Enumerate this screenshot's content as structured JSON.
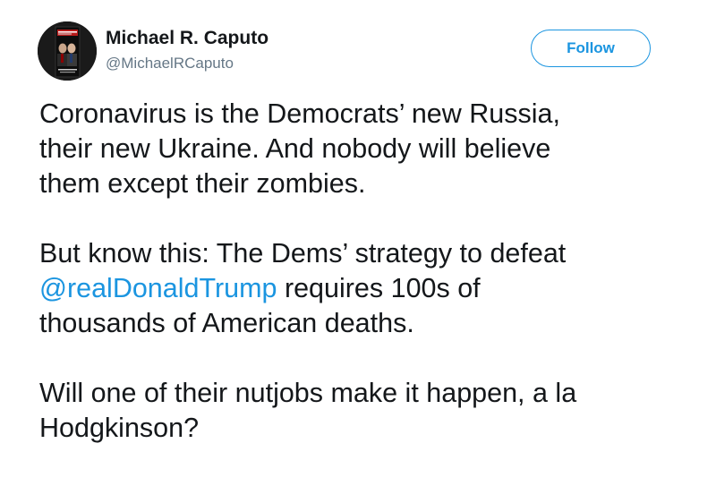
{
  "author": {
    "name": "Michael R. Caputo",
    "handle": "@MichaelRCaputo"
  },
  "follow_button": {
    "label": "Follow"
  },
  "tweet": {
    "p1_l1": "Coronavirus is the Democrats’ new Russia,",
    "p1_l2": "their new Ukraine. And nobody will believe",
    "p1_l3": "them except their zombies.",
    "p2_l1": "But know this: The Dems’ strategy to defeat",
    "mention": "@realDonaldTrump",
    "p2_l2_rest": " requires 100s of",
    "p2_l3": "thousands of American deaths.",
    "p3_l1": "Will one of their nutjobs make it happen, a la",
    "p3_l2": "Hodgkinson?"
  },
  "colors": {
    "link": "#1b95e0",
    "text": "#14171a",
    "muted": "#657786"
  },
  "icons": {
    "avatar": "book-cover-avatar"
  }
}
